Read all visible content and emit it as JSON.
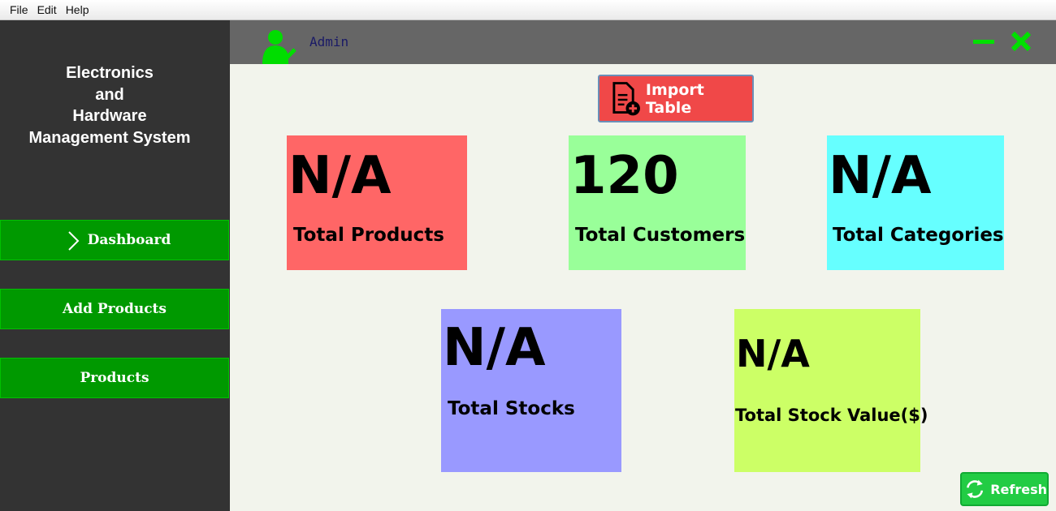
{
  "menu": {
    "items": [
      "File",
      "Edit",
      "Help"
    ]
  },
  "sidebar": {
    "title_lines": [
      "Electronics",
      "and",
      "Hardware",
      "Management System"
    ],
    "nav": [
      {
        "label": "Dashboard",
        "active": true
      },
      {
        "label": "Add Products"
      },
      {
        "label": "Products"
      }
    ]
  },
  "header": {
    "user": "Admin",
    "user_icon": "user-check-icon",
    "minimize_icon": "minimize-icon",
    "close_icon": "close-icon"
  },
  "actions": {
    "import_label": "Import Table",
    "refresh_label": "Refresh"
  },
  "cards": {
    "products": {
      "value": "N/A",
      "label": "Total Products"
    },
    "customers": {
      "value": "120",
      "label": "Total Customers"
    },
    "categories": {
      "value": "N/A",
      "label": "Total Categories"
    },
    "stocks": {
      "value": "N/A",
      "label": "Total Stocks"
    },
    "stock_value": {
      "value": "N/A",
      "label": "Total Stock Value($)"
    }
  },
  "colors": {
    "sidebar_bg": "#333333",
    "nav_green": "#009900",
    "header_bg": "#666666",
    "icon_green": "#00e000",
    "products": "#ff6666",
    "customers": "#99ff99",
    "categories": "#66ffff",
    "stocks": "#9999ff",
    "stock_value": "#ccff66",
    "import_btn": "#f04848",
    "refresh_btn": "#22cc44"
  }
}
